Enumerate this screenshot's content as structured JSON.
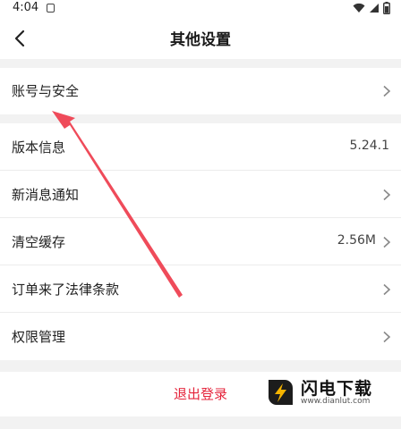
{
  "status_bar": {
    "time": "4:04"
  },
  "header": {
    "title": "其他设置"
  },
  "settings": {
    "account_security": {
      "label": "账号与安全"
    },
    "version_info": {
      "label": "版本信息",
      "value": "5.24.1"
    },
    "new_message_notification": {
      "label": "新消息通知"
    },
    "clear_cache": {
      "label": "清空缓存",
      "value": "2.56M"
    },
    "order_legal_terms": {
      "label": "订单来了法律条款"
    },
    "permission_management": {
      "label": "权限管理"
    }
  },
  "logout": {
    "label": "退出登录"
  },
  "watermark": {
    "name": "闪电下载",
    "url": "www.dianlut.com"
  },
  "colors": {
    "accent_red": "#e5243b",
    "annotation_arrow": "#ef4b5a",
    "background": "#f2f2f2"
  },
  "icons": [
    "back-arrow-icon",
    "chevron-right-icon",
    "wifi-icon",
    "signal-icon",
    "battery-icon",
    "notification-icon",
    "lightning-logo-icon"
  ]
}
